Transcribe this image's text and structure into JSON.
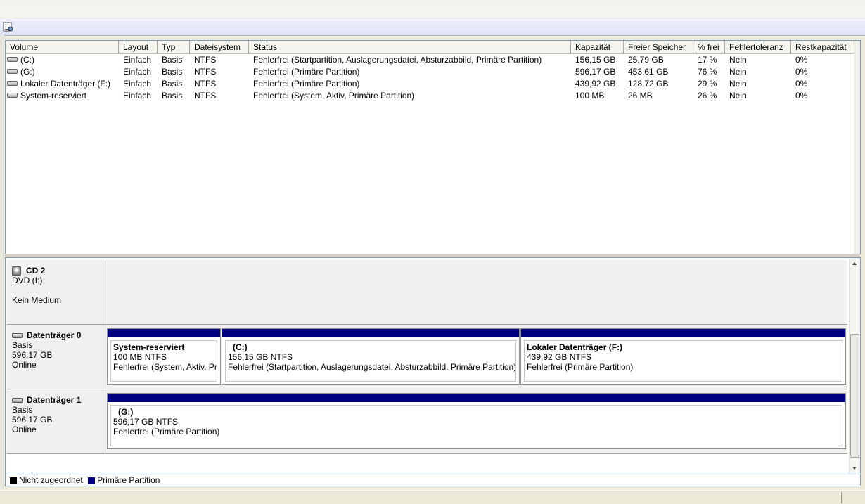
{
  "colors": {
    "primary_partition": "#000080",
    "unallocated": "#000000"
  },
  "toolbar": {
    "icon": "properties-icon"
  },
  "volume_list": {
    "columns": [
      "Volume",
      "Layout",
      "Typ",
      "Dateisystem",
      "Status",
      "Kapazität",
      "Freier Speicher",
      "% frei",
      "Fehlertoleranz",
      "Restkapazität"
    ],
    "rows": [
      [
        "(C:)",
        "Einfach",
        "Basis",
        "NTFS",
        "Fehlerfrei (Startpartition, Auslagerungsdatei, Absturzabbild, Primäre Partition)",
        "156,15 GB",
        "25,79 GB",
        "17 %",
        "Nein",
        "0%"
      ],
      [
        "(G:)",
        "Einfach",
        "Basis",
        "NTFS",
        "Fehlerfrei (Primäre Partition)",
        "596,17 GB",
        "453,61 GB",
        "76 %",
        "Nein",
        "0%"
      ],
      [
        "Lokaler Datenträger (F:)",
        "Einfach",
        "Basis",
        "NTFS",
        "Fehlerfrei (Primäre Partition)",
        "439,92 GB",
        "128,72 GB",
        "29 %",
        "Nein",
        "0%"
      ],
      [
        "System-reserviert",
        "Einfach",
        "Basis",
        "NTFS",
        "Fehlerfrei (System, Aktiv, Primäre Partition)",
        "100 MB",
        "26 MB",
        "26 %",
        "Nein",
        "0%"
      ]
    ]
  },
  "disks": [
    {
      "name": "CD 2",
      "line1": "DVD (I:)",
      "line2": "",
      "line3": "Kein Medium",
      "partitions": []
    },
    {
      "name": "Datenträger 0",
      "line1": "Basis",
      "line2": "596,17 GB",
      "line3": "Online",
      "partitions": [
        {
          "name": "System-reserviert",
          "size": "100 MB NTFS",
          "status": "Fehlerfrei (System, Aktiv, Primäre Partition)"
        },
        {
          "name": "(C:)",
          "size": "156,15 GB NTFS",
          "status": "Fehlerfrei (Startpartition, Auslagerungsdatei, Absturzabbild, Primäre Partition)"
        },
        {
          "name": "Lokaler Datenträger  (F:)",
          "size": "439,92 GB NTFS",
          "status": "Fehlerfrei (Primäre Partition)"
        }
      ]
    },
    {
      "name": "Datenträger 1",
      "line1": "Basis",
      "line2": "596,17 GB",
      "line3": "Online",
      "partitions": [
        {
          "name": "(G:)",
          "size": "596,17 GB NTFS",
          "status": "Fehlerfrei (Primäre Partition)"
        }
      ]
    }
  ],
  "legend": {
    "unallocated": "Nicht zugeordnet",
    "primary": "Primäre Partition"
  }
}
